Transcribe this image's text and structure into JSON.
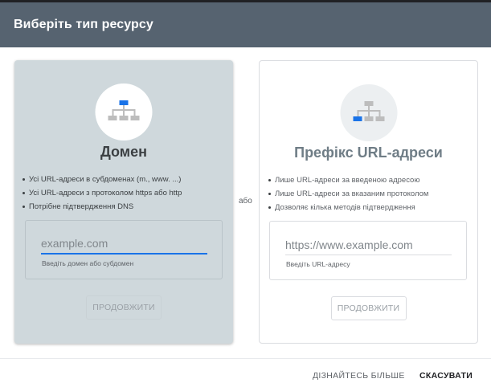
{
  "dialog": {
    "title": "Виберіть тип ресурсу",
    "or_label": "або"
  },
  "domain_card": {
    "title": "Домен",
    "bullets": [
      "Усі URL-адреси в субдоменах (m., www. ...)",
      "Усі URL-адреси з протоколом https або http",
      "Потрібне підтвердження DNS"
    ],
    "input_placeholder": "example.com",
    "input_value": "",
    "helper": "Введіть домен або субдомен",
    "button": "ПРОДОВЖИТИ",
    "icon": "domain-tree-icon"
  },
  "prefix_card": {
    "title": "Префікс URL-адреси",
    "bullets": [
      "Лише URL-адреси за введеною адресою",
      "Лише URL-адреси за вказаним протоколом",
      "Дозволяє кілька методів підтвердження"
    ],
    "input_placeholder": "https://www.example.com",
    "input_value": "",
    "helper": "Введіть URL-адресу",
    "button": "ПРОДОВЖИТИ",
    "icon": "url-prefix-tree-icon"
  },
  "footer": {
    "learn_more": "ДІЗНАЙТЕСЬ БІЛЬШЕ",
    "cancel": "СКАСУВАТИ"
  },
  "colors": {
    "header": "#566370",
    "selected_card": "#cfd8dc",
    "accent_blue": "#1a73e8",
    "tree_gray": "#bdbdbd"
  }
}
